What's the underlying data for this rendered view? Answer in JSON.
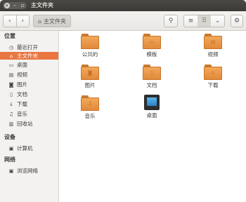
{
  "window": {
    "title": "主文件夹",
    "close": "×",
    "minimize": "–",
    "maximize": "▫"
  },
  "toolbar": {
    "back": "‹",
    "forward": "›",
    "path_icon": "home-icon",
    "path_label": "主文件夹",
    "search": "⚲",
    "list_view": "≡",
    "grid_view": "⠿",
    "view_menu": "⌄",
    "settings": "⚙"
  },
  "sidebar": {
    "places_header": "位置",
    "places": [
      {
        "label": "最近打开",
        "icon": "recent-icon"
      },
      {
        "label": "主文件夹",
        "icon": "home-icon",
        "active": true
      },
      {
        "label": "桌面",
        "icon": "desktop-icon"
      },
      {
        "label": "视频",
        "icon": "video-icon"
      },
      {
        "label": "图片",
        "icon": "pictures-icon"
      },
      {
        "label": "文档",
        "icon": "document-icon"
      },
      {
        "label": "下载",
        "icon": "download-icon"
      },
      {
        "label": "音乐",
        "icon": "music-icon"
      },
      {
        "label": "回收站",
        "icon": "trash-icon"
      }
    ],
    "devices_header": "设备",
    "devices": [
      {
        "label": "计算机",
        "icon": "computer-icon"
      }
    ],
    "network_header": "网络",
    "network": [
      {
        "label": "浏览网络",
        "icon": "network-icon"
      }
    ]
  },
  "files": [
    {
      "label": "公共的",
      "type": "folder"
    },
    {
      "label": "模板",
      "type": "folder"
    },
    {
      "label": "视频",
      "type": "folder"
    },
    {
      "label": "图片",
      "type": "folder"
    },
    {
      "label": "文档",
      "type": "folder"
    },
    {
      "label": "下载",
      "type": "folder"
    },
    {
      "label": "音乐",
      "type": "folder"
    },
    {
      "label": "桌面",
      "type": "desktop"
    }
  ],
  "colors": {
    "accent": "#e97640",
    "folder": "#f2a85a",
    "titlebar": "#3b3a36"
  }
}
